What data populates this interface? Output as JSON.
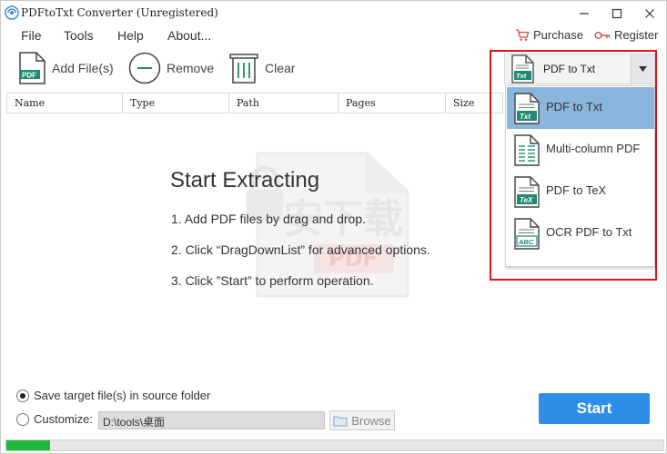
{
  "window": {
    "title": "PDFtoTxt Converter (Unregistered)"
  },
  "menu": {
    "file": "File",
    "tools": "Tools",
    "help": "Help",
    "about": "About..."
  },
  "top_links": {
    "purchase": "Purchase",
    "register": "Register"
  },
  "toolbar": {
    "add_files": "Add File(s)",
    "remove": "Remove",
    "clear": "Clear"
  },
  "mode_dropdown": {
    "selected": "PDF to Txt",
    "options": [
      {
        "label": "PDF to Txt",
        "icon": "txt-document-icon",
        "badge": "Txt",
        "selected": true
      },
      {
        "label": "Multi-column PDF",
        "icon": "multicolumn-document-icon",
        "badge": "",
        "selected": false
      },
      {
        "label": "PDF to TeX",
        "icon": "tex-document-icon",
        "badge": "TeX",
        "selected": false
      },
      {
        "label": "OCR PDF to Txt",
        "icon": "ocr-document-icon",
        "badge": "ABC",
        "selected": false
      }
    ]
  },
  "file_table": {
    "columns": [
      "Name",
      "Type",
      "Path",
      "Pages",
      "Size"
    ]
  },
  "instructions": {
    "title": "Start Extracting",
    "steps": [
      "1. Add PDF files by drag and drop.",
      "2. Click “DragDownList” for advanced options.",
      "3. Click ”Start” to perform operation."
    ]
  },
  "output": {
    "save_source": "Save target file(s) in source folder",
    "customize": "Customize:",
    "custom_path": "D:\\tools\\桌面",
    "browse": "Browse",
    "selected_option": "source"
  },
  "start_label": "Start",
  "progress_fraction": 0.067,
  "watermark": {
    "text": "安下载",
    "badge": "PDF"
  },
  "colors": {
    "accent_blue": "#2e8ee8",
    "selection_blue": "#8ab5dc",
    "highlight_red": "#e01616",
    "progress_green": "#1fb83a",
    "icon_teal": "#1f8a74"
  }
}
